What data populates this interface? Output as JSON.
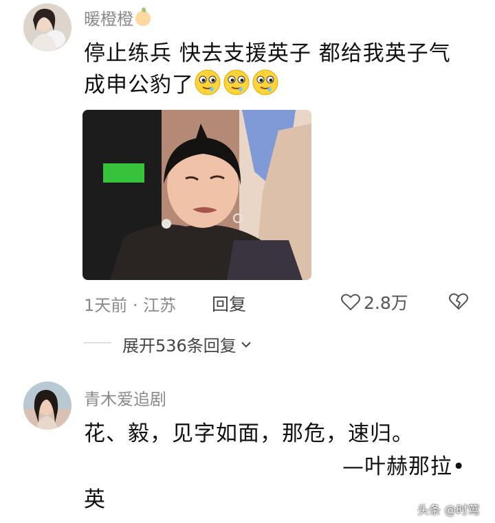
{
  "comments": [
    {
      "username": "暖橙橙",
      "username_badge_icon": "orange-icon",
      "text_line1": "停止练兵 快去支援英子 都给我英子气",
      "text_line2": "成申公豹了",
      "emoji_count": 3,
      "emoji_icon": "drooling-face-icon",
      "time_location": "1天前 · 江苏",
      "reply_label": "回复",
      "like_count": "2.8万",
      "expand_replies": "展开536条回复"
    },
    {
      "username": "青木爱追剧",
      "text_line1": "花、毅，见字如面，那危，速归。",
      "text_line2": "—叶赫那拉•",
      "text_line3": "英"
    }
  ],
  "watermark": "头条 @时莺",
  "colors": {
    "username": "#8a8a8a",
    "text": "#111111",
    "meta": "#8a8a8a"
  }
}
